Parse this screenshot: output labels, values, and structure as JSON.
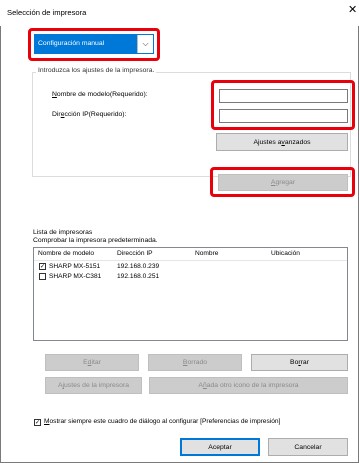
{
  "window": {
    "title": "Selección de impresora",
    "close_glyph": "✕"
  },
  "mode_select": {
    "value": "Configuración manual",
    "arrow": "⌵"
  },
  "settings_group": {
    "legend": "Introduzca los ajustes de la impresora.",
    "model_label_hotkey": "N",
    "model_label_rest": "ombre de modelo(Requerido):",
    "model_value": "",
    "ip_label_pre": "Dir",
    "ip_label_hotkey": "e",
    "ip_label_post": "cción IP(Requerido):",
    "ip_value": "",
    "advanced_pre": "Ajustes a",
    "advanced_hotkey": "v",
    "advanced_post": "anzados"
  },
  "add_button": {
    "label": "Agregar",
    "hotkey": "A",
    "rest": "gregar"
  },
  "printer_list": {
    "title": "Lista de impresoras",
    "subtitle": "Comprobar la impresora predeterminada.",
    "columns": [
      "Nombre de modelo",
      "Dirección IP",
      "Nombre",
      "Ubicación"
    ],
    "rows": [
      {
        "checked": true,
        "model": "SHARP MX-5151",
        "ip": "192.168.0.239",
        "name": "",
        "location": ""
      },
      {
        "checked": false,
        "model": "SHARP MX-C381",
        "ip": "192.168.0.251",
        "name": "",
        "location": ""
      }
    ]
  },
  "action_buttons": {
    "edit_pre": "E",
    "edit_hotkey": "d",
    "edit_post": "itar",
    "delete_hotkey": "B",
    "delete_post": "orrado",
    "remove_pre": "Bo",
    "remove_hotkey": "r",
    "remove_post": "rar",
    "printer_settings_pre": "A",
    "printer_settings_hotkey": "j",
    "printer_settings_post": "ustes de la impresora",
    "add_icon_pre": "A",
    "add_icon_hotkey": "ñ",
    "add_icon_post": "ada otro icono de la impresora"
  },
  "always_show": {
    "checked": true,
    "hotkey": "M",
    "label_rest": "ostrar siempre este cuadro de diálogo al configurar [Preferencias de impresión]"
  },
  "footer": {
    "accept_label": "Aceptar",
    "cancel_label": "Cancelar"
  },
  "colors": {
    "highlight": "#e8000b",
    "accent": "#0078d7"
  }
}
